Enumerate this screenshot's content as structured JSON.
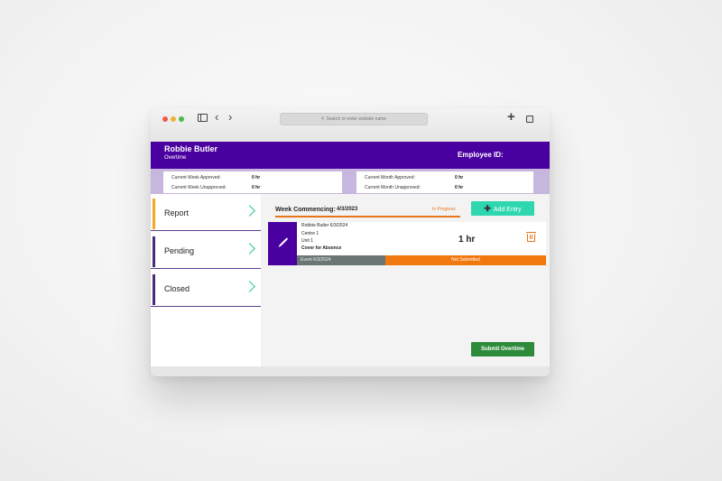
{
  "browser": {
    "address_placeholder": "Search or enter website name"
  },
  "header": {
    "name": "Robbie Butler",
    "subtitle": "Overtime",
    "employee_id_label": "Employee ID:"
  },
  "stats": {
    "week_approved_label": "Current Week Approved:",
    "week_approved_value": "0 hr",
    "week_unapproved_label": "Current Week Unapproved:",
    "week_unapproved_value": "0 hr",
    "month_approved_label": "Current Month Approved:",
    "month_approved_value": "0 hr",
    "month_unapproved_label": "Current Month Unapproved:",
    "month_unapproved_value": "0 hr"
  },
  "nav": {
    "items": [
      {
        "label": "Report",
        "color": "#f5a623"
      },
      {
        "label": "Pending",
        "color": "#4b2a7a"
      },
      {
        "label": "Closed",
        "color": "#4b2a7a"
      }
    ]
  },
  "main": {
    "week_label": "Week Commencing:",
    "week_date": "4/3/2023",
    "status": "In Progress",
    "add_entry": "Add Entry",
    "entry": {
      "line1": "Robbie Butler 6/3/2024",
      "line2": "Centre 1",
      "line3": "Unit 1",
      "line4": "Cover for Absence",
      "hours": "1 hr",
      "event": "Event 6/3/2024",
      "submission_status": "Not Submitted"
    },
    "submit": "Submit Overtime"
  },
  "colors": {
    "brand_purple": "#4a00a0",
    "accent_teal": "#2ed7b0",
    "accent_orange": "#f0780f",
    "submit_green": "#2e8b3c"
  }
}
